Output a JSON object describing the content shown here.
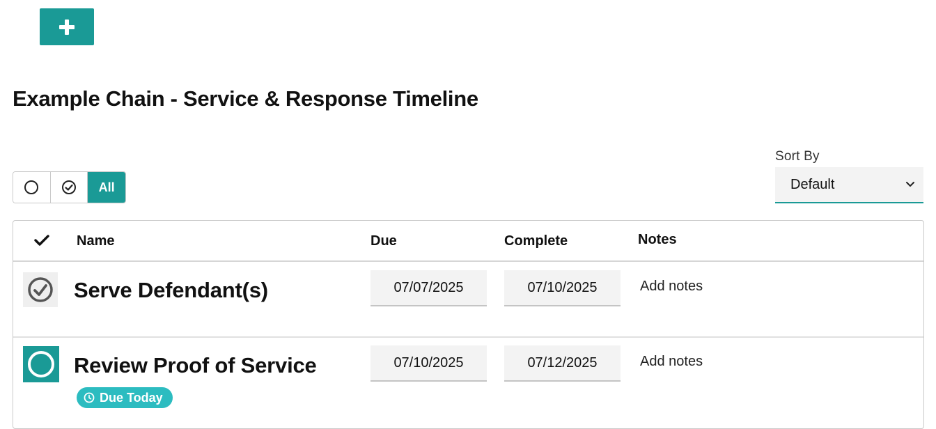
{
  "toolbar": {
    "add_icon": "plus-icon"
  },
  "page": {
    "title": "Example Chain - Service & Response Timeline"
  },
  "filters": {
    "items": [
      {
        "icon": "open-circle-icon",
        "label": ""
      },
      {
        "icon": "check-circle-icon",
        "label": ""
      },
      {
        "label": "All",
        "active": true
      }
    ]
  },
  "sort": {
    "label": "Sort By",
    "value": "Default",
    "icon": "chevron-down-icon"
  },
  "table": {
    "headers": {
      "check_icon": "checkmark-icon",
      "name": "Name",
      "due": "Due",
      "complete": "Complete",
      "notes": "Notes"
    },
    "rows": [
      {
        "status": "completed",
        "name": "Serve Defendant(s)",
        "due": "07/07/2025",
        "complete": "07/10/2025",
        "notes": "Add notes"
      },
      {
        "status": "open",
        "name": "Review Proof of Service",
        "badge": "Due Today",
        "due": "07/10/2025",
        "complete": "07/12/2025",
        "notes": "Add notes"
      }
    ]
  },
  "colors": {
    "accent": "#1a9a96",
    "badge": "#2cbcc0"
  }
}
